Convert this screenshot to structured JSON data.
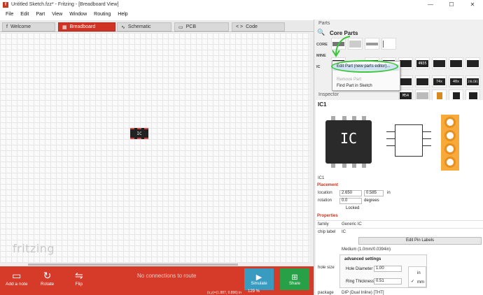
{
  "window": {
    "app_icon": "f",
    "title": "Untitled Sketch.fzz* - Fritzing - [Breadboard View]",
    "minimize": "—",
    "maximize": "☐",
    "close": "✕"
  },
  "menu": [
    "File",
    "Edit",
    "Part",
    "View",
    "Window",
    "Routing",
    "Help"
  ],
  "tabs": [
    {
      "label": "Welcome",
      "icon": "f"
    },
    {
      "label": "Breadboard",
      "icon": "▦"
    },
    {
      "label": "Schematic",
      "icon": "∿"
    },
    {
      "label": "PCB",
      "icon": "▭"
    },
    {
      "label": "Code",
      "icon": "< >"
    }
  ],
  "canvas": {
    "part_label": "IC",
    "logo": "fritzing"
  },
  "bottom_bar": {
    "add_note": "Add a note",
    "rotate": "Rotate",
    "flip": "Flip",
    "no_connections": "No connections to route",
    "simulate": "Simulate",
    "share": "Share",
    "status": "(x,y)=(1.887, 0.896) in",
    "zoom": "129 %",
    "accent": "#d63a29"
  },
  "parts": {
    "header": "Parts",
    "bin_title": "Core Parts",
    "bins": [
      "CORE",
      "MINE",
      "IC"
    ],
    "tiles": [
      "74x",
      "40x",
      "4N35",
      "M54",
      "24LC01"
    ]
  },
  "context_menu": {
    "items": [
      {
        "label": "Edit Part (new parts editor)...",
        "state": "highlighted"
      },
      {
        "label": "",
        "state": "disabled"
      },
      {
        "label": "Remove Part",
        "state": "disabled"
      },
      {
        "label": "Find Part in Sketch",
        "state": "normal"
      }
    ]
  },
  "inspector": {
    "header": "Inspector",
    "part_title": "IC1",
    "image_chip_label": "IC",
    "part_name": "IC1",
    "placement_label": "Placement",
    "location_label": "location",
    "location_x": "2.650",
    "location_y": "0.585",
    "location_unit": "in",
    "rotation_label": "rotation",
    "rotation_value": "0.0",
    "rotation_unit": "degrees",
    "locked_label": "Locked",
    "properties_label": "Properties",
    "family_label": "family",
    "family_value": "Generic IC",
    "chip_label_label": "chip label",
    "chip_label_value": "IC",
    "edit_pins_button": "Edit Pin Labels",
    "hole_size_label": "hole size",
    "hole_size_value": "Medium (1.0mm/0.0394in)",
    "advanced_settings": "advanced settings",
    "hole_diameter_label": "Hole Diameter",
    "hole_diameter_value": "1.00",
    "ring_thickness_label": "Ring Thickness",
    "ring_thickness_value": "0.51",
    "unit_in": "in",
    "unit_mm": "mm",
    "package_label": "package",
    "package_value": "DIP (Dual Inline) [THT]"
  }
}
